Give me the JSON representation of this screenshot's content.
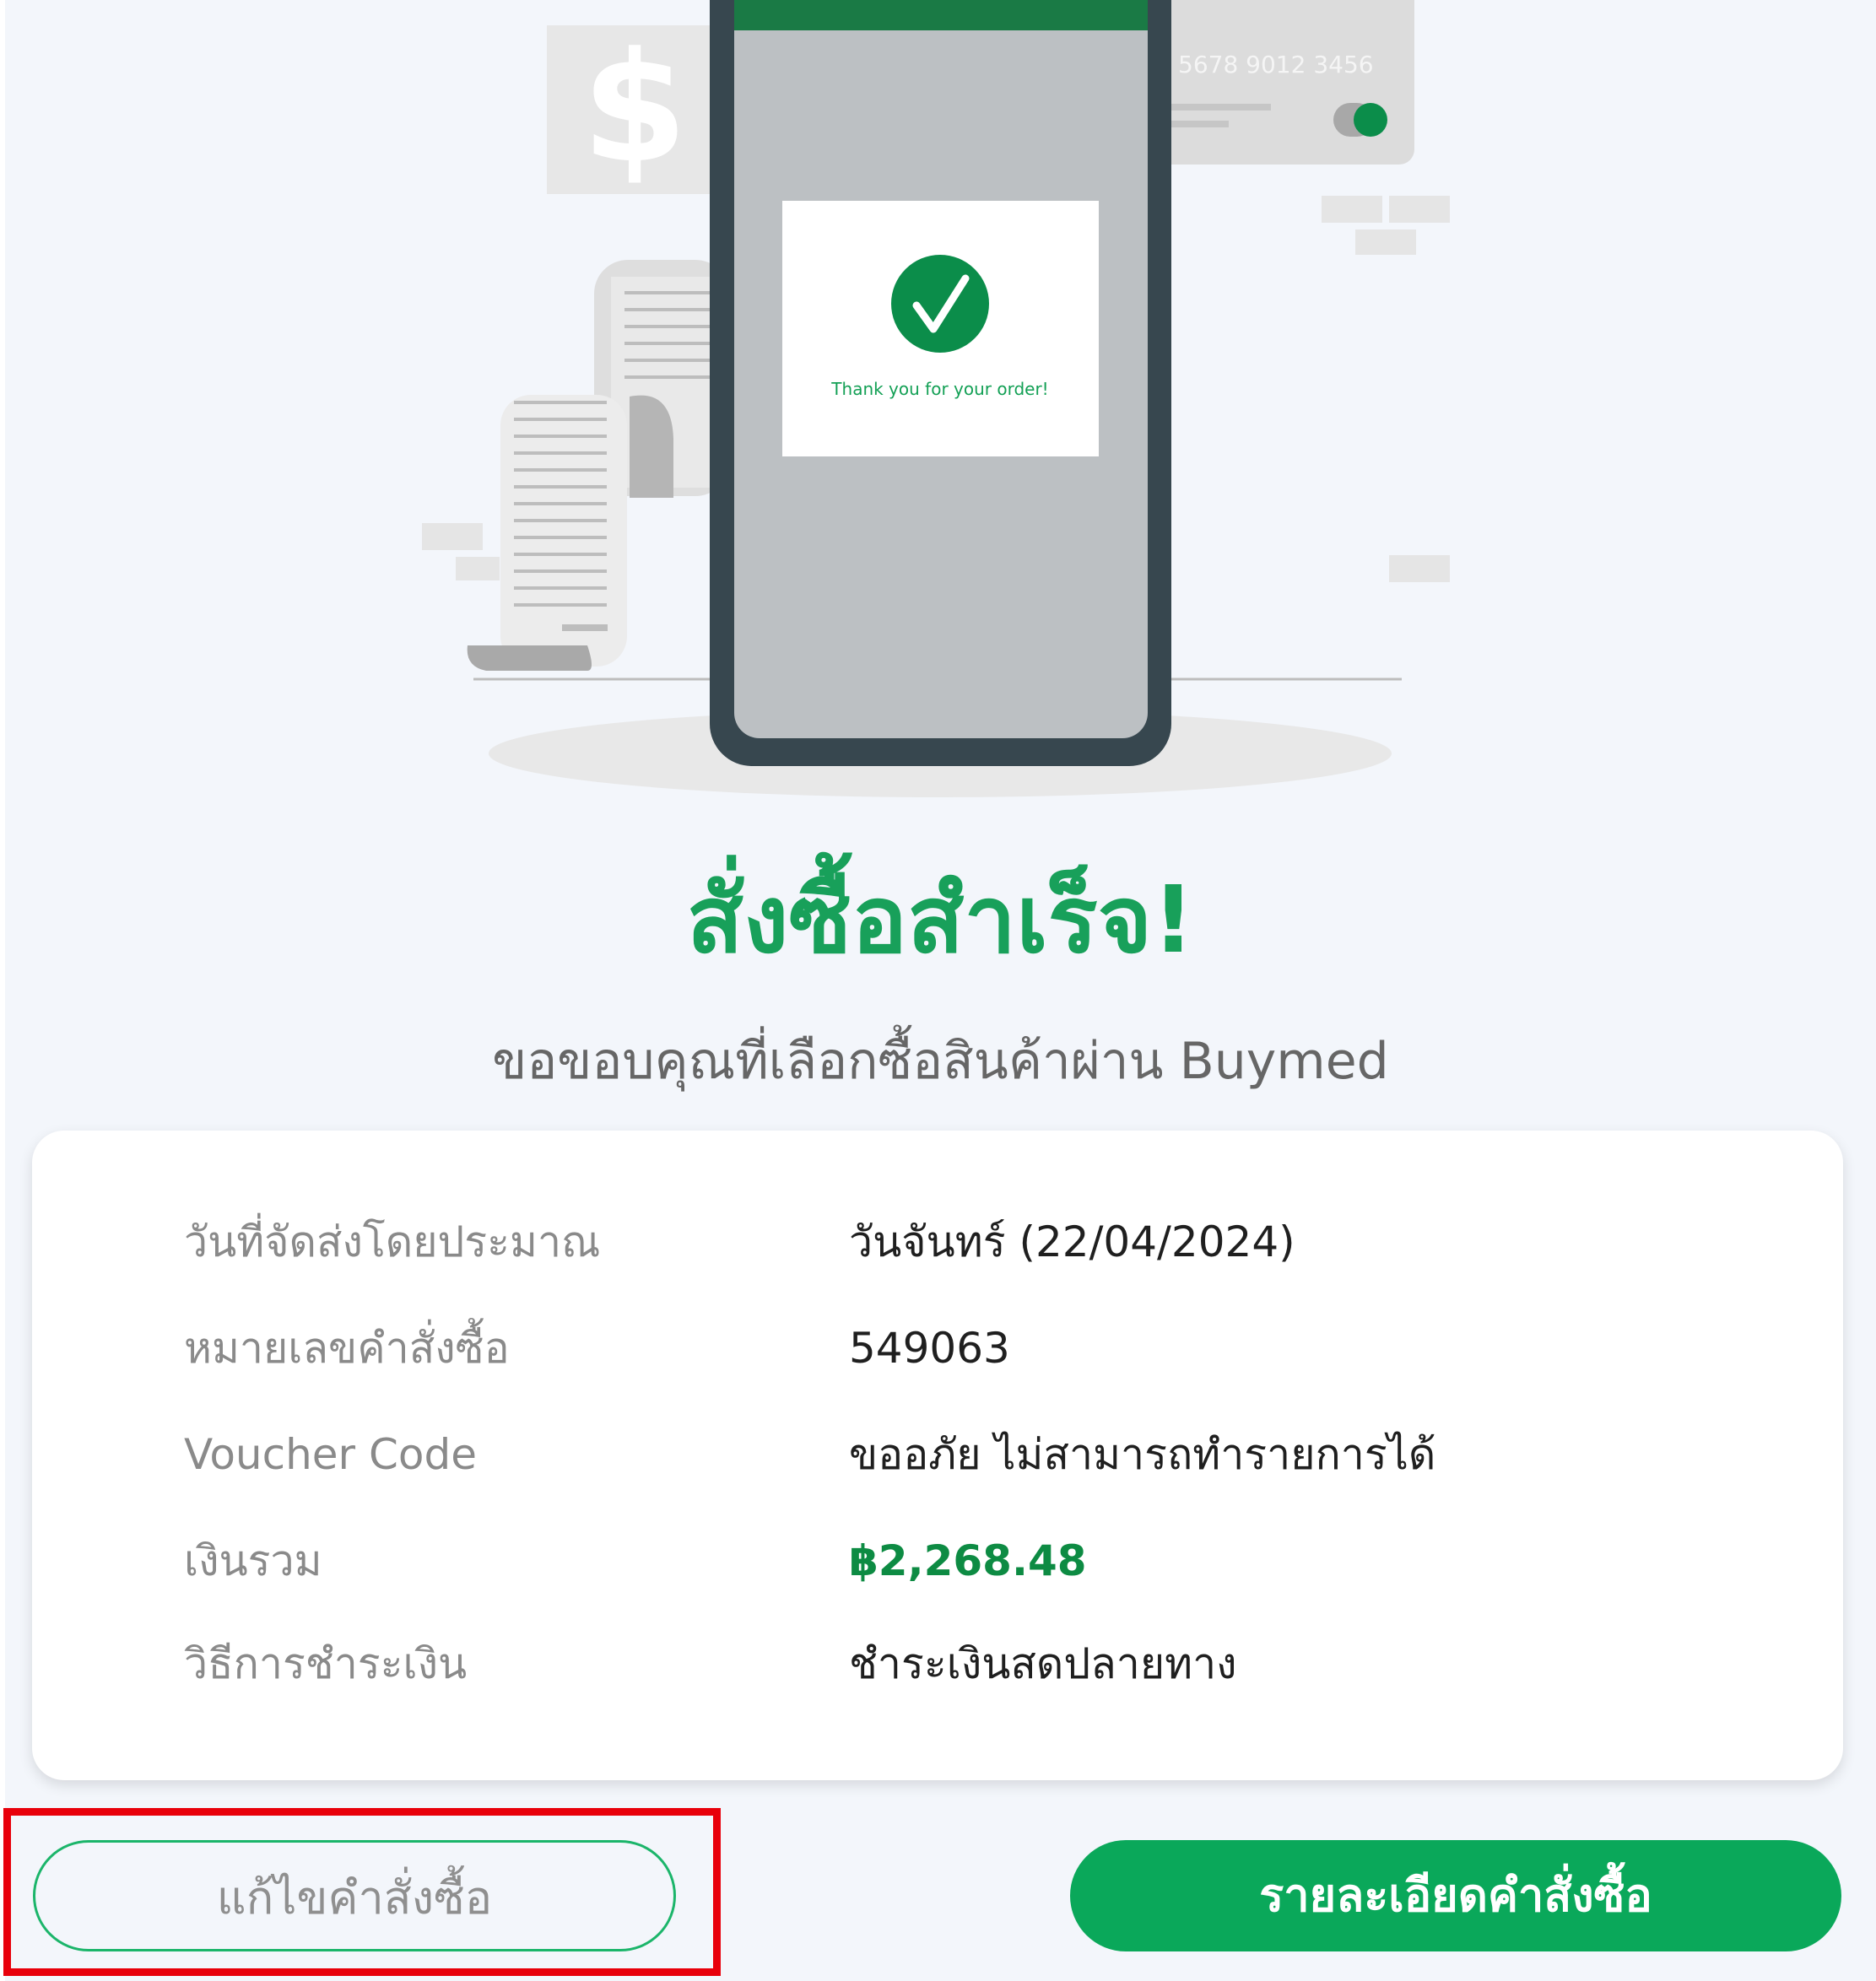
{
  "illustration": {
    "card_number": "5678  9012  3456",
    "phone_message": "Thank you for your order!"
  },
  "header": {
    "title": "สั่งซื้อสำเร็จ!",
    "subtitle": "ขอขอบคุณที่เลือกซื้อสินค้าผ่าน Buymed"
  },
  "details": [
    {
      "label": "วันที่จัดส่งโดยประมาณ",
      "value": "วันจันทร์ (22/04/2024)"
    },
    {
      "label": "หมายเลขคำสั่งซื้อ",
      "value": "549063"
    },
    {
      "label": "Voucher Code",
      "value": "ขออภัย ไม่สามารถทำรายการได้"
    },
    {
      "label": "เงินรวม",
      "value": "฿2,268.48"
    },
    {
      "label": "วิธีการชำระเงิน",
      "value": "ชำระเงินสดปลายทาง"
    }
  ],
  "buttons": {
    "edit_order": "แก้ไขคำสั่งซื้อ",
    "order_details": "รายละเอียดคำสั่งซื้อ"
  },
  "colors": {
    "accent_green": "#18a05a",
    "button_green": "#0aa85a",
    "highlight_red": "#e8000b",
    "phone_frame": "#37474f"
  }
}
